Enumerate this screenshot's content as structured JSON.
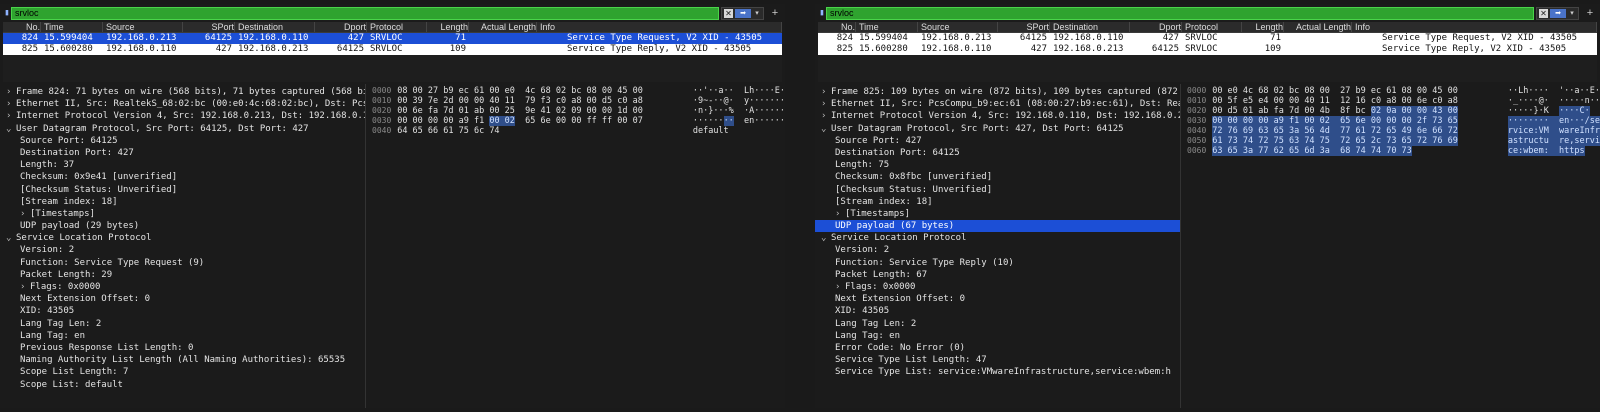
{
  "left": {
    "filter": {
      "value": "srvloc"
    },
    "columns": [
      "No.",
      "Time",
      "Source",
      "SPort",
      "Destination",
      "Dport",
      "Protocol",
      "Length",
      "Actual Length",
      "Info"
    ],
    "packets": [
      {
        "no": "824",
        "time": "15.599404",
        "src": "192.168.0.213",
        "sport": "64125",
        "dst": "192.168.0.110",
        "dport": "427",
        "proto": "SRVLOC",
        "len": "71",
        "alen": "",
        "info": "Service Type Request, V2 XID - 43505"
      },
      {
        "no": "825",
        "time": "15.600280",
        "src": "192.168.0.110",
        "sport": "427",
        "dst": "192.168.0.213",
        "dport": "64125",
        "proto": "SRVLOC",
        "len": "109",
        "alen": "",
        "info": "Service Type Reply, V2 XID - 43505"
      }
    ],
    "details": [
      "Frame 824: 71 bytes on wire (568 bits), 71 bytes captured (568 bi",
      "Ethernet II, Src: RealtekS_68:02:bc (00:e0:4c:68:02:bc), Dst: Pcs",
      "Internet Protocol Version 4, Src: 192.168.0.213, Dst: 192.168.0.1",
      "User Datagram Protocol, Src Port: 64125, Dst Port: 427",
      "Source Port: 64125",
      "Destination Port: 427",
      "Length: 37",
      "Checksum: 0x9e41 [unverified]",
      "[Checksum Status: Unverified]",
      "[Stream index: 18]",
      "[Timestamps]",
      "UDP payload (29 bytes)",
      "Service Location Protocol",
      "Version: 2",
      "Function: Service Type Request (9)",
      "Packet Length: 29",
      "Flags: 0x0000",
      "Next Extension Offset: 0",
      "XID: 43505",
      "Lang Tag Len: 2",
      "Lang Tag: en",
      "Previous Response List Length: 0",
      "Naming Authority List Length (All Naming Authorities): 65535",
      "Scope List Length: 7",
      "Scope List: default"
    ],
    "offsets": [
      "0000",
      "0010",
      "0020",
      "0030",
      "0040"
    ],
    "hex": [
      "08 00 27 b9 ec 61 00 e0  4c 68 02 bc 08 00 45 00",
      "00 39 7e 2d 00 00 40 11  79 f3 c0 a8 00 d5 c0 a8",
      "00 6e fa 7d 01 ab 00 25  9e 41 02 09 00 00 1d 00",
      "00 00 00 00 a9 f1 ",
      "64 65 66 61 75 6c 74"
    ],
    "hex_sel": [
      "",
      "",
      "",
      "00 02",
      ""
    ],
    "hex_tail": [
      "",
      "",
      "",
      "  65 6e 00 00 ff ff 00 07",
      ""
    ],
    "ascii": [
      "··'··a··  Lh····E·",
      "·9~-··@·  y·······",
      "·n·}···%  ·A······",
      "······",
      "default"
    ],
    "ascii_sel": [
      "",
      "",
      "",
      "··",
      ""
    ],
    "ascii_tail": [
      "",
      "",
      "",
      "  en······",
      ""
    ]
  },
  "right": {
    "filter": {
      "value": "srvloc"
    },
    "columns": [
      "No.",
      "Time",
      "Source",
      "SPort",
      "Destination",
      "Dport",
      "Protocol",
      "Length",
      "Actual Length",
      "Info"
    ],
    "packets": [
      {
        "no": "824",
        "time": "15.599404",
        "src": "192.168.0.213",
        "sport": "64125",
        "dst": "192.168.0.110",
        "dport": "427",
        "proto": "SRVLOC",
        "len": "71",
        "alen": "",
        "info": "Service Type Request, V2 XID - 43505"
      },
      {
        "no": "825",
        "time": "15.600280",
        "src": "192.168.0.110",
        "sport": "427",
        "dst": "192.168.0.213",
        "dport": "64125",
        "proto": "SRVLOC",
        "len": "109",
        "alen": "",
        "info": "Service Type Reply, V2 XID - 43505"
      }
    ],
    "details": [
      "Frame 825: 109 bytes on wire (872 bits), 109 bytes captured (872",
      "Ethernet II, Src: PcsCompu_b9:ec:61 (08:00:27:b9:ec:61), Dst: Rea",
      "Internet Protocol Version 4, Src: 192.168.0.110, Dst: 192.168.0.2",
      "User Datagram Protocol, Src Port: 427, Dst Port: 64125",
      "Source Port: 427",
      "Destination Port: 64125",
      "Length: 75",
      "Checksum: 0x8fbc [unverified]",
      "[Checksum Status: Unverified]",
      "[Stream index: 18]",
      "[Timestamps]",
      "UDP payload (67 bytes)",
      "Service Location Protocol",
      "Version: 2",
      "Function: Service Type Reply (10)",
      "Packet Length: 67",
      "Flags: 0x0000",
      "Next Extension Offset: 0",
      "XID: 43505",
      "Lang Tag Len: 2",
      "Lang Tag: en",
      "Error Code: No Error (0)",
      "Service Type List Length: 47",
      "Service Type List: service:VMwareInfrastructure,service:wbem:h"
    ],
    "offsets": [
      "0000",
      "0010",
      "0020",
      "0030",
      "0040",
      "0050",
      "0060"
    ],
    "hex_pre": [
      "00 e0 4c 68 02 bc 08 00  27 b9 ec 61 08 00 45 00",
      "00 5f e5 e4 00 00 40 11  12 16 c0 a8 00 6e c0 a8",
      "00 d5 01 ab fa 7d 00 4b  8f bc ",
      "",
      "",
      "",
      ""
    ],
    "hex_sel": [
      "",
      "",
      "02 0a 00 00 43 00",
      "00 00 00 00 a9 f1 00 02  65 6e 00 00 00 2f 73 65",
      "72 76 69 63 65 3a 56 4d  77 61 72 65 49 6e 66 72",
      "61 73 74 72 75 63 74 75  72 65 2c 73 65 72 76 69",
      "63 65 3a 77 62 65 6d 3a  68 74 74 70 73"
    ],
    "ascii_pre": [
      "··Lh····  '··a··E·",
      "·_····@·  ·····n··",
      "·····}·K  ",
      "",
      "",
      "",
      ""
    ],
    "ascii_sel": [
      "",
      "",
      "····C·",
      "········  en···/se",
      "rvice:VM  wareInfr",
      "astructu  re,servi",
      "ce:wbem:  https"
    ]
  }
}
